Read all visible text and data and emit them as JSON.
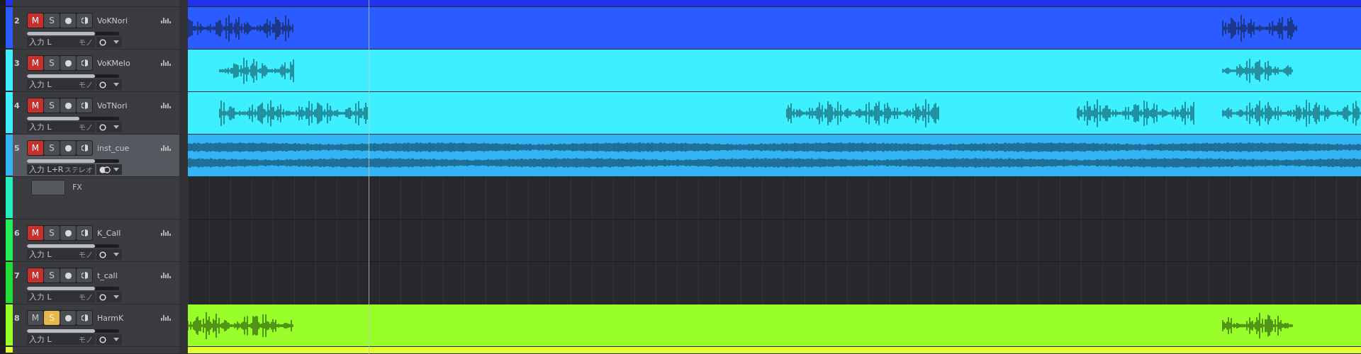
{
  "tracks": [
    {
      "kind": "cut",
      "color": "#2233ee"
    },
    {
      "kind": "audio",
      "mute_label": "M",
      "solo_label": "S",
      "number": "2",
      "name": "VoKNori",
      "color": "#2b5cff",
      "muted": true,
      "soloed": false,
      "selected": false,
      "level": 0.74,
      "input": "入力 L",
      "mode": "モノ",
      "stereo": false
    },
    {
      "kind": "audio",
      "mute_label": "M",
      "solo_label": "S",
      "number": "3",
      "name": "VoKMelo",
      "color": "#3ef0ff",
      "muted": true,
      "soloed": false,
      "selected": false,
      "level": 0.74,
      "input": "入力 L",
      "mode": "モノ",
      "stereo": false
    },
    {
      "kind": "audio",
      "mute_label": "M",
      "solo_label": "S",
      "number": "4",
      "name": "VoTNori",
      "color": "#3ef0ff",
      "muted": true,
      "soloed": false,
      "selected": false,
      "level": 0.57,
      "input": "入力 L",
      "mode": "モノ",
      "stereo": false
    },
    {
      "kind": "audio",
      "mute_label": "M",
      "solo_label": "S",
      "number": "5",
      "name": "inst_cue",
      "color": "#33b4f4",
      "muted": true,
      "soloed": false,
      "selected": true,
      "level": 0.74,
      "input": "入力 L+R",
      "mode": "ステレオ",
      "stereo": true
    },
    {
      "kind": "fx",
      "name": "FX",
      "color": "#22f0c0"
    },
    {
      "kind": "audio",
      "mute_label": "M",
      "solo_label": "S",
      "number": "6",
      "name": "K_Call",
      "color": "#22ee55",
      "muted": true,
      "soloed": false,
      "selected": false,
      "level": 0.74,
      "input": "入力 L",
      "mode": "モノ",
      "stereo": false
    },
    {
      "kind": "audio",
      "mute_label": "M",
      "solo_label": "S",
      "number": "7",
      "name": "t_call",
      "color": "#22dd33",
      "muted": true,
      "soloed": false,
      "selected": false,
      "level": 0.74,
      "input": "入力 L",
      "mode": "モノ",
      "stereo": false
    },
    {
      "kind": "audio",
      "mute_label": "M",
      "solo_label": "S",
      "number": "8",
      "name": "HarmK",
      "color": "#99ff2a",
      "muted": false,
      "soloed": true,
      "selected": false,
      "level": 0.74,
      "input": "入力 L",
      "mode": "モノ",
      "stereo": false
    },
    {
      "kind": "cut",
      "color": "#e6ff2e"
    }
  ]
}
